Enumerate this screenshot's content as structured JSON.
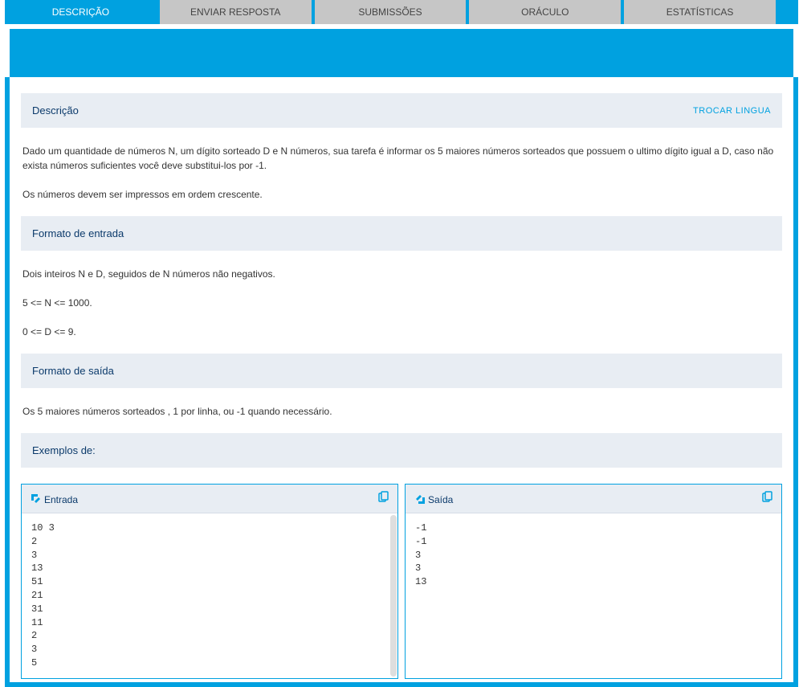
{
  "tabs": {
    "descricao": "DESCRIÇÃO",
    "enviar": "ENVIAR RESPOSTA",
    "submissoes": "SUBMISSÕES",
    "oraculo": "ORÁCULO",
    "estatisticas": "ESTATÍSTICAS"
  },
  "descricao": {
    "title": "Descrição",
    "trocar": "TROCAR LINGUA",
    "p1": "Dado um quantidade de números N,  um dígito sorteado D e N números, sua tarefa é informar os 5 maiores números sorteados que possuem o ultimo dígito igual a D, caso não exista números suficientes você deve substitui-los por -1.",
    "p2": "Os números devem ser impressos em ordem crescente."
  },
  "entrada": {
    "title": "Formato de entrada",
    "p1": "Dois inteiros N e D, seguidos de N números não negativos.",
    "p2": "5 <= N <= 1000.",
    "p3": "0 <= D <= 9."
  },
  "saida": {
    "title": "Formato de saída",
    "p1": "Os 5 maiores números sorteados , 1 por linha, ou -1 quando necessário."
  },
  "exemplos": {
    "title": "Exemplos de:",
    "entrada_label": "Entrada",
    "saida_label": "Saída",
    "entrada_text": "10 3\n2\n3\n13\n51\n21\n31\n11\n2\n3\n5",
    "saida_text": "-1\n-1\n3\n3\n13"
  }
}
